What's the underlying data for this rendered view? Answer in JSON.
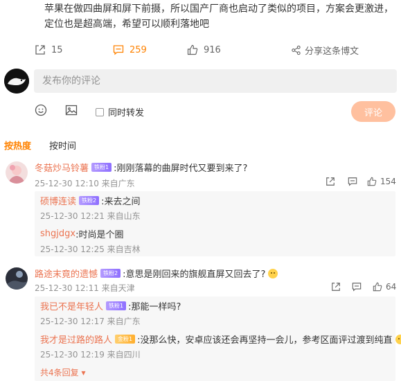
{
  "post": {
    "line1": "苹果在做四曲屏和屏下前摄，所以国产厂商也启动了类似的项目，方案会更激进，",
    "line2": "定位也是超高端，希望可以顺利落地吧"
  },
  "actions": {
    "repost_count": "15",
    "comment_count": "259",
    "like_count": "916",
    "share_label": "分享这条博文"
  },
  "compose": {
    "placeholder": "发布你的评论",
    "repost_label": "同时转发",
    "submit_label": "评论"
  },
  "sort": {
    "hot": "按热度",
    "time": "按时间"
  },
  "comments": [
    {
      "user": "冬菇炒马铃薯",
      "badge": "铁粉1",
      "text": ":刚刚落幕的曲屏时代又要到来了?",
      "meta": "25-12-30 12:10 来自广东",
      "likes": "154",
      "replies": [
        {
          "user": "硕博连读",
          "badge": "铁粉2",
          "text": ":来去之间",
          "meta": "25-12-30 12:21 来自山东"
        },
        {
          "user": "shgjdgx",
          "text": ":时尚是个圈",
          "meta": "25-12-30 12:25 来自吉林"
        }
      ]
    },
    {
      "user": "路途末竟的遗憾",
      "badge": "铁粉2",
      "text": ":意思是刚回来的旗舰直屏又回去了?",
      "meta": "25-12-30 12:11 来自天津",
      "likes": "64",
      "replies": [
        {
          "user": "我已不是年轻人",
          "badge": "铁粉1",
          "text": ":那能一样吗?",
          "meta": "25-12-30 12:17 来自广东"
        },
        {
          "user": "我才是过路的路人",
          "badge": "金粉1",
          "text": ":没那么快，安卓应该还会再坚持一会儿，参考区面评过渡到纯直",
          "meta": "25-12-30 12:19 来自四川"
        }
      ],
      "more": "共4条回复"
    }
  ],
  "colors": {
    "accent": "#ff8200",
    "username": "#eb7350",
    "button": "#ffc09f"
  }
}
